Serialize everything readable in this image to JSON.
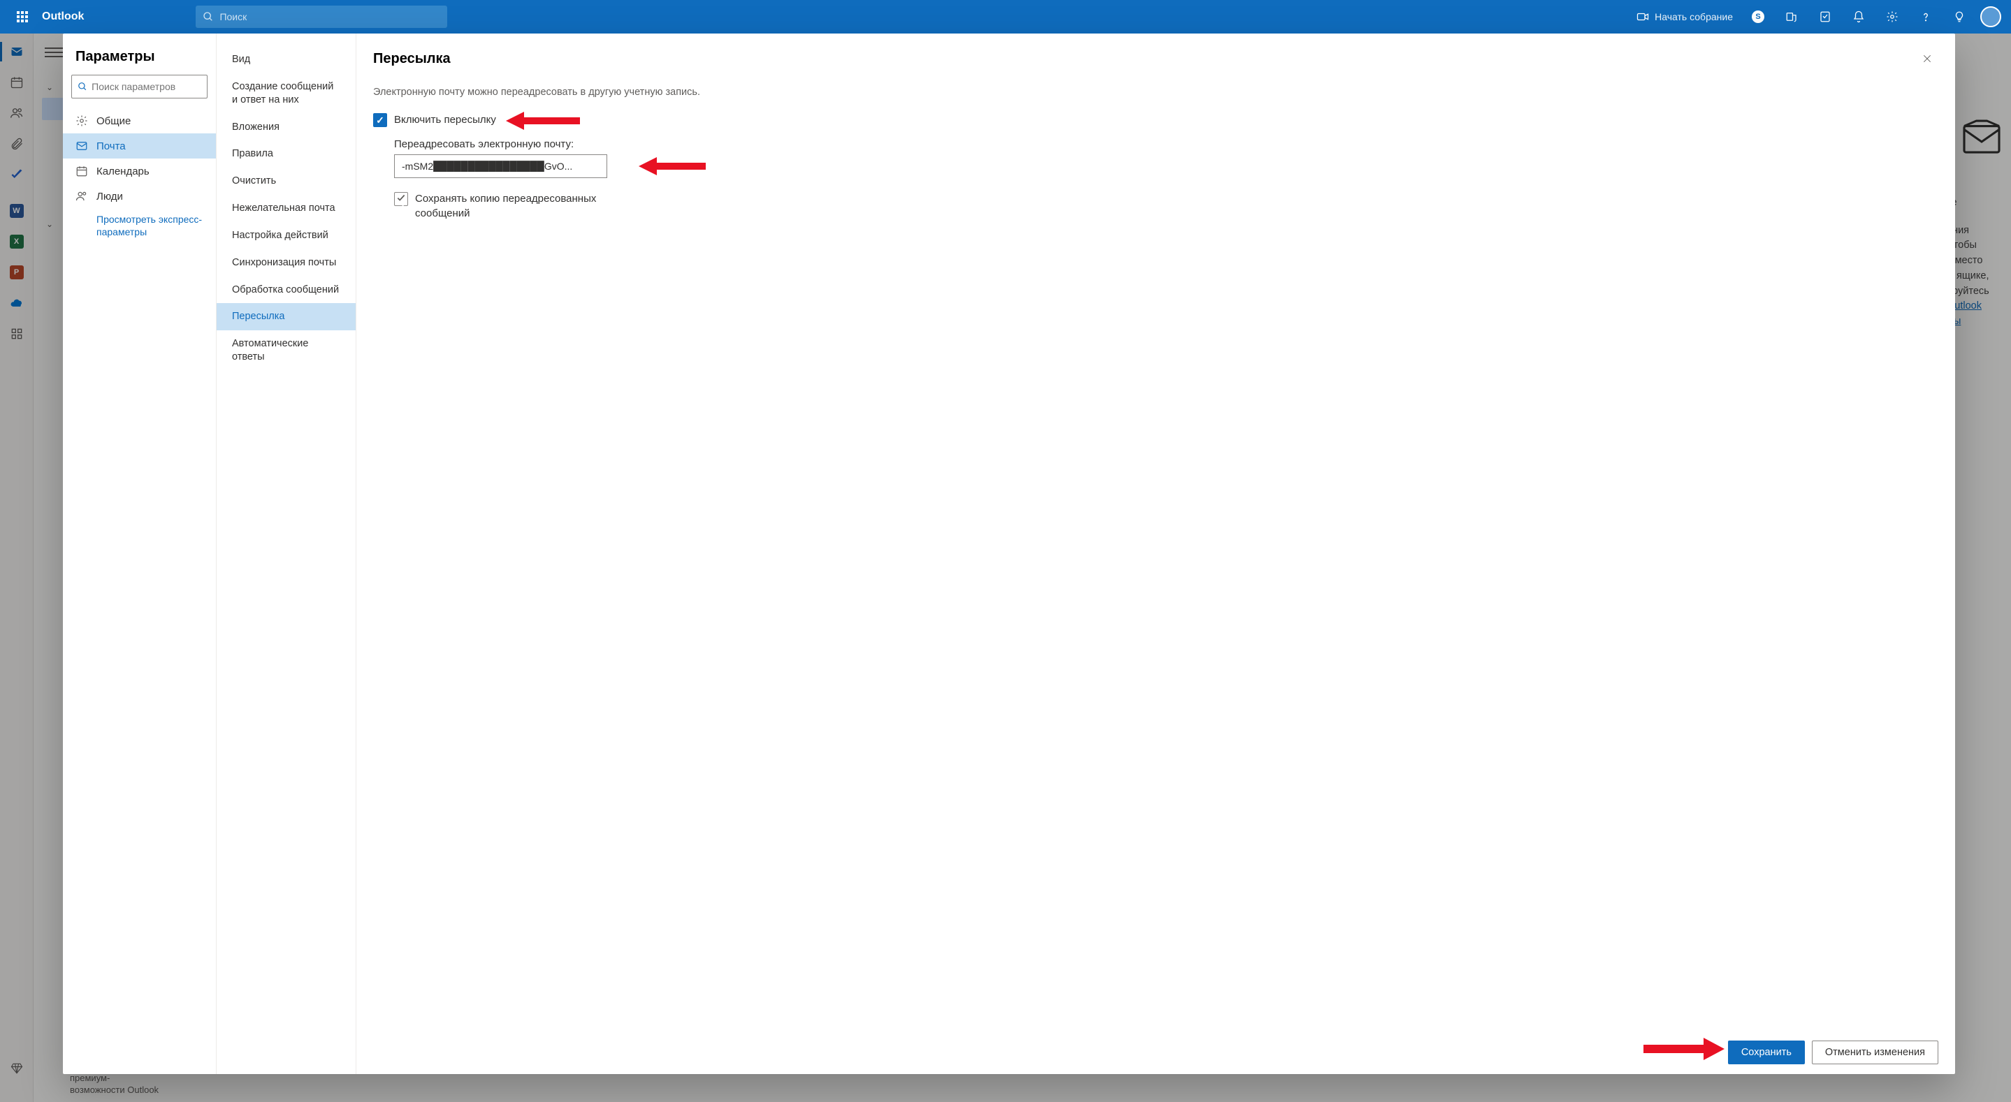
{
  "header": {
    "brand": "Outlook",
    "search_placeholder": "Поиск",
    "meeting_label": "Начать собрание",
    "skype_chip": "S"
  },
  "background": {
    "premium_line1": "премиум-",
    "premium_line2": "возможности Outlook",
    "right_text_1": "ы",
    "right_text_2": "те",
    "right_text_3": "ания",
    "right_text_4": "Чтобы",
    "right_text_5": "ь место",
    "right_text_6": "м ящике,",
    "right_text_7": "ируйтесь",
    "right_link_1": "Outlook",
    "right_link_2": "мы"
  },
  "settings": {
    "title": "Параметры",
    "search_placeholder": "Поиск параметров",
    "categories": {
      "general": "Общие",
      "mail": "Почта",
      "calendar": "Календарь",
      "people": "Люди"
    },
    "quick_settings_link": "Просмотреть экспресс-параметры",
    "subcategories": {
      "layout": "Вид",
      "compose": "Создание сообщений и ответ на них",
      "attachments": "Вложения",
      "rules": "Правила",
      "sweep": "Очистить",
      "junk": "Нежелательная почта",
      "customize": "Настройка действий",
      "sync": "Синхронизация почты",
      "handling": "Обработка сообщений",
      "forwarding": "Пересылка",
      "autoreply": "Автоматические ответы"
    },
    "panel": {
      "title": "Пересылка",
      "description": "Электронную почту можно переадресовать в другую учетную запись.",
      "enable_label": "Включить пересылку",
      "forward_to_label": "Переадресовать электронную почту:",
      "forward_value": "-mSM2████████████████GvO...",
      "keep_copy_label": "Сохранять копию переадресованных сообщений",
      "save_label": "Сохранить",
      "cancel_label": "Отменить изменения"
    }
  }
}
